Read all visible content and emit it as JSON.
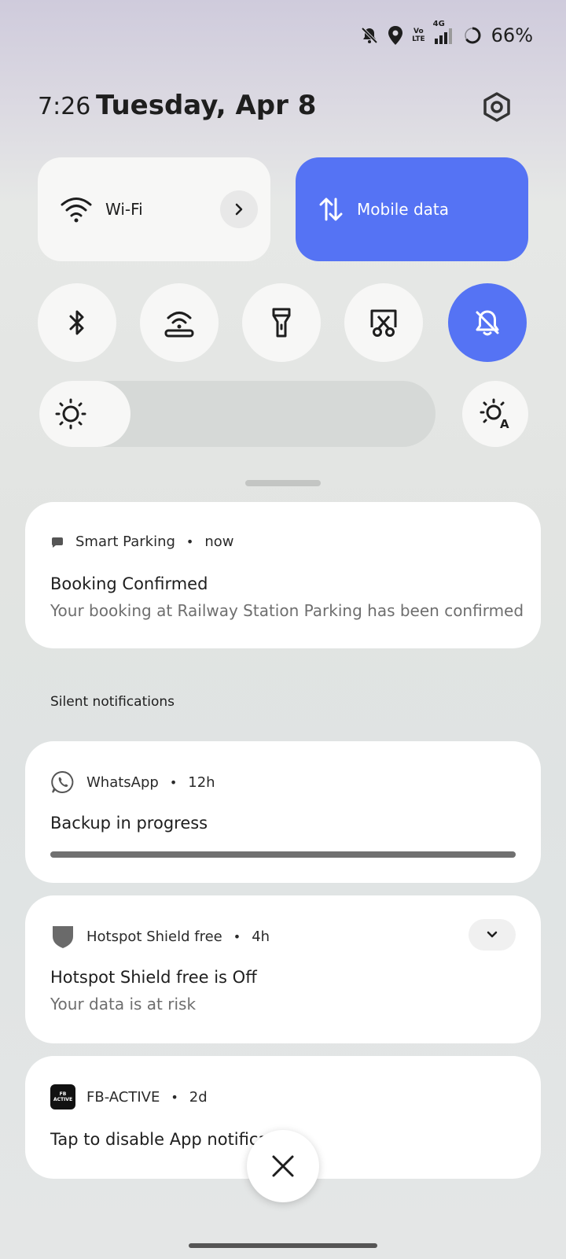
{
  "status_bar": {
    "volte_line1": "Vo",
    "volte_line2": "LTE",
    "network_type": "4G",
    "battery_percent": "66%",
    "icons": [
      "bell-off-icon",
      "location-pin-icon",
      "volte-icon",
      "signal-icon",
      "battery-ring-icon"
    ]
  },
  "header": {
    "time": "7:26",
    "date": "Tuesday, Apr 8"
  },
  "quick_tiles": {
    "wifi_label": "Wi-Fi",
    "mobile_data_label": "Mobile data",
    "toggles": [
      {
        "name": "bluetooth",
        "active": false
      },
      {
        "name": "hotspot",
        "active": false
      },
      {
        "name": "flashlight",
        "active": false
      },
      {
        "name": "screenshot",
        "active": false
      },
      {
        "name": "silent",
        "active": true
      }
    ]
  },
  "brightness": {
    "level": 0.23
  },
  "notifications": [
    {
      "app": "Smart Parking",
      "time": "now",
      "title": "Booking Confirmed",
      "text": "Your booking at Railway Station Parking has been confirmed"
    }
  ],
  "silent_section": {
    "label": "Silent notifications",
    "items": [
      {
        "app": "WhatsApp",
        "time": "12h",
        "title": "Backup in progress",
        "progress": 1.0
      },
      {
        "app": "Hotspot Shield free",
        "time": "4h",
        "title": "Hotspot Shield free is Off",
        "text": "Your data is at risk"
      },
      {
        "app": "FB-ACTIVE",
        "time": "2d",
        "title": "Tap to disable App notificati",
        "icon_text": "FB ACTIVE"
      }
    ]
  },
  "colors": {
    "accent": "#5573f4",
    "tile_bg": "#f7f7f6",
    "card_bg": "#ffffff"
  }
}
